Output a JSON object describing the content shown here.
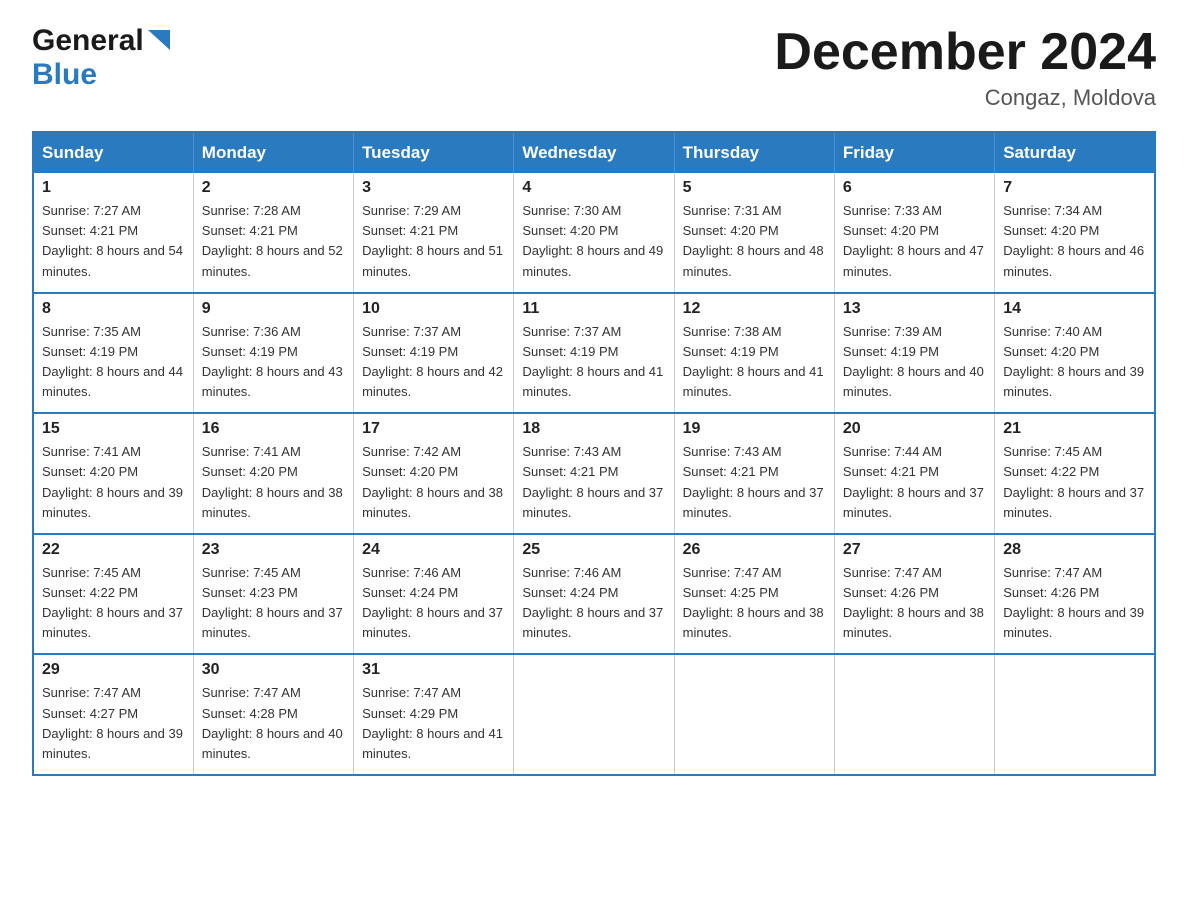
{
  "logo": {
    "line1": "General",
    "line2": "Blue"
  },
  "title": "December 2024",
  "location": "Congaz, Moldova",
  "weekdays": [
    "Sunday",
    "Monday",
    "Tuesday",
    "Wednesday",
    "Thursday",
    "Friday",
    "Saturday"
  ],
  "weeks": [
    [
      {
        "day": "1",
        "sunrise": "Sunrise: 7:27 AM",
        "sunset": "Sunset: 4:21 PM",
        "daylight": "Daylight: 8 hours and 54 minutes."
      },
      {
        "day": "2",
        "sunrise": "Sunrise: 7:28 AM",
        "sunset": "Sunset: 4:21 PM",
        "daylight": "Daylight: 8 hours and 52 minutes."
      },
      {
        "day": "3",
        "sunrise": "Sunrise: 7:29 AM",
        "sunset": "Sunset: 4:21 PM",
        "daylight": "Daylight: 8 hours and 51 minutes."
      },
      {
        "day": "4",
        "sunrise": "Sunrise: 7:30 AM",
        "sunset": "Sunset: 4:20 PM",
        "daylight": "Daylight: 8 hours and 49 minutes."
      },
      {
        "day": "5",
        "sunrise": "Sunrise: 7:31 AM",
        "sunset": "Sunset: 4:20 PM",
        "daylight": "Daylight: 8 hours and 48 minutes."
      },
      {
        "day": "6",
        "sunrise": "Sunrise: 7:33 AM",
        "sunset": "Sunset: 4:20 PM",
        "daylight": "Daylight: 8 hours and 47 minutes."
      },
      {
        "day": "7",
        "sunrise": "Sunrise: 7:34 AM",
        "sunset": "Sunset: 4:20 PM",
        "daylight": "Daylight: 8 hours and 46 minutes."
      }
    ],
    [
      {
        "day": "8",
        "sunrise": "Sunrise: 7:35 AM",
        "sunset": "Sunset: 4:19 PM",
        "daylight": "Daylight: 8 hours and 44 minutes."
      },
      {
        "day": "9",
        "sunrise": "Sunrise: 7:36 AM",
        "sunset": "Sunset: 4:19 PM",
        "daylight": "Daylight: 8 hours and 43 minutes."
      },
      {
        "day": "10",
        "sunrise": "Sunrise: 7:37 AM",
        "sunset": "Sunset: 4:19 PM",
        "daylight": "Daylight: 8 hours and 42 minutes."
      },
      {
        "day": "11",
        "sunrise": "Sunrise: 7:37 AM",
        "sunset": "Sunset: 4:19 PM",
        "daylight": "Daylight: 8 hours and 41 minutes."
      },
      {
        "day": "12",
        "sunrise": "Sunrise: 7:38 AM",
        "sunset": "Sunset: 4:19 PM",
        "daylight": "Daylight: 8 hours and 41 minutes."
      },
      {
        "day": "13",
        "sunrise": "Sunrise: 7:39 AM",
        "sunset": "Sunset: 4:19 PM",
        "daylight": "Daylight: 8 hours and 40 minutes."
      },
      {
        "day": "14",
        "sunrise": "Sunrise: 7:40 AM",
        "sunset": "Sunset: 4:20 PM",
        "daylight": "Daylight: 8 hours and 39 minutes."
      }
    ],
    [
      {
        "day": "15",
        "sunrise": "Sunrise: 7:41 AM",
        "sunset": "Sunset: 4:20 PM",
        "daylight": "Daylight: 8 hours and 39 minutes."
      },
      {
        "day": "16",
        "sunrise": "Sunrise: 7:41 AM",
        "sunset": "Sunset: 4:20 PM",
        "daylight": "Daylight: 8 hours and 38 minutes."
      },
      {
        "day": "17",
        "sunrise": "Sunrise: 7:42 AM",
        "sunset": "Sunset: 4:20 PM",
        "daylight": "Daylight: 8 hours and 38 minutes."
      },
      {
        "day": "18",
        "sunrise": "Sunrise: 7:43 AM",
        "sunset": "Sunset: 4:21 PM",
        "daylight": "Daylight: 8 hours and 37 minutes."
      },
      {
        "day": "19",
        "sunrise": "Sunrise: 7:43 AM",
        "sunset": "Sunset: 4:21 PM",
        "daylight": "Daylight: 8 hours and 37 minutes."
      },
      {
        "day": "20",
        "sunrise": "Sunrise: 7:44 AM",
        "sunset": "Sunset: 4:21 PM",
        "daylight": "Daylight: 8 hours and 37 minutes."
      },
      {
        "day": "21",
        "sunrise": "Sunrise: 7:45 AM",
        "sunset": "Sunset: 4:22 PM",
        "daylight": "Daylight: 8 hours and 37 minutes."
      }
    ],
    [
      {
        "day": "22",
        "sunrise": "Sunrise: 7:45 AM",
        "sunset": "Sunset: 4:22 PM",
        "daylight": "Daylight: 8 hours and 37 minutes."
      },
      {
        "day": "23",
        "sunrise": "Sunrise: 7:45 AM",
        "sunset": "Sunset: 4:23 PM",
        "daylight": "Daylight: 8 hours and 37 minutes."
      },
      {
        "day": "24",
        "sunrise": "Sunrise: 7:46 AM",
        "sunset": "Sunset: 4:24 PM",
        "daylight": "Daylight: 8 hours and 37 minutes."
      },
      {
        "day": "25",
        "sunrise": "Sunrise: 7:46 AM",
        "sunset": "Sunset: 4:24 PM",
        "daylight": "Daylight: 8 hours and 37 minutes."
      },
      {
        "day": "26",
        "sunrise": "Sunrise: 7:47 AM",
        "sunset": "Sunset: 4:25 PM",
        "daylight": "Daylight: 8 hours and 38 minutes."
      },
      {
        "day": "27",
        "sunrise": "Sunrise: 7:47 AM",
        "sunset": "Sunset: 4:26 PM",
        "daylight": "Daylight: 8 hours and 38 minutes."
      },
      {
        "day": "28",
        "sunrise": "Sunrise: 7:47 AM",
        "sunset": "Sunset: 4:26 PM",
        "daylight": "Daylight: 8 hours and 39 minutes."
      }
    ],
    [
      {
        "day": "29",
        "sunrise": "Sunrise: 7:47 AM",
        "sunset": "Sunset: 4:27 PM",
        "daylight": "Daylight: 8 hours and 39 minutes."
      },
      {
        "day": "30",
        "sunrise": "Sunrise: 7:47 AM",
        "sunset": "Sunset: 4:28 PM",
        "daylight": "Daylight: 8 hours and 40 minutes."
      },
      {
        "day": "31",
        "sunrise": "Sunrise: 7:47 AM",
        "sunset": "Sunset: 4:29 PM",
        "daylight": "Daylight: 8 hours and 41 minutes."
      },
      null,
      null,
      null,
      null
    ]
  ]
}
